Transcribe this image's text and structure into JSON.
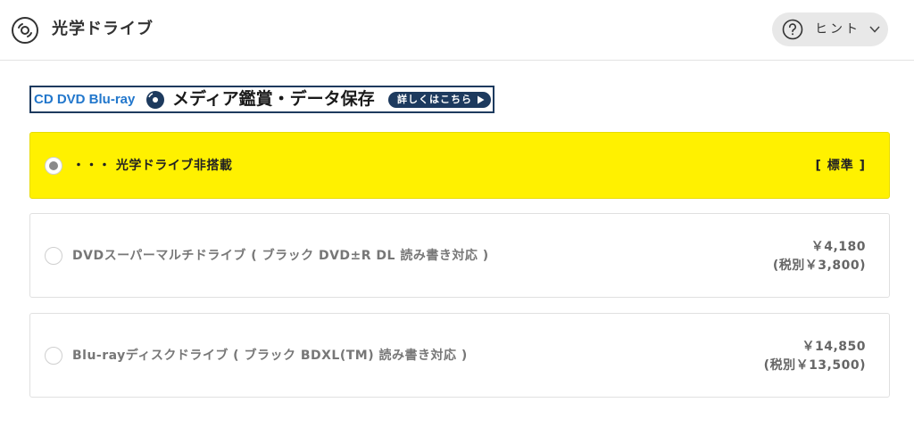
{
  "header": {
    "icon": "disc-icon",
    "title": "光学ドライブ",
    "hint": {
      "icon": "question-circle-icon",
      "label": "ヒント",
      "chevron": "chevron-down-icon"
    }
  },
  "banner": {
    "brand": "CD DVD Blu-ray",
    "disc_icon": "disc-icon",
    "headline": "メディア鑑賞・データ保存",
    "cta_label": "詳しくはこちら",
    "cta_arrow": "play-arrow-icon",
    "colors": {
      "frame": "#1d3a5e",
      "brand": "#2277cc"
    }
  },
  "options": [
    {
      "label": "・・・ 光学ドライブ非搭載",
      "tag": "[ 標準 ]",
      "selected": true,
      "highlight_color": "#fff100"
    },
    {
      "label": "DVDスーパーマルチドライブ ( ブラック DVD±R DL 読み書き対応 )",
      "price": "￥4,180",
      "price_excl": "(税別￥3,800)",
      "selected": false
    },
    {
      "label": "Blu-rayディスクドライブ ( ブラック BDXL(TM) 読み書き対応 )",
      "price": "￥14,850",
      "price_excl": "(税別￥13,500)",
      "selected": false
    }
  ]
}
